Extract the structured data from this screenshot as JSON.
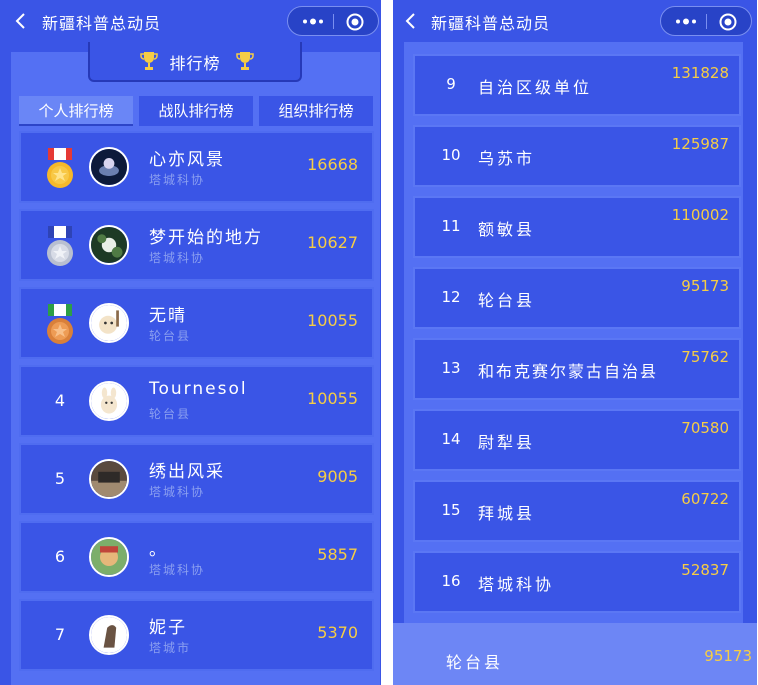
{
  "app": {
    "title": "新疆科普总动员"
  },
  "banner": {
    "label": "排行榜"
  },
  "tabs": [
    {
      "label": "个人排行榜"
    },
    {
      "label": "战队排行榜"
    },
    {
      "label": "组织排行榜"
    }
  ],
  "personal": [
    {
      "rank": "1",
      "name": "心亦风景",
      "org": "塔城科协",
      "score": "16668",
      "medal": "gold-medal-icon"
    },
    {
      "rank": "2",
      "name": "梦开始的地方",
      "org": "塔城科协",
      "score": "10627",
      "medal": "silver-medal-icon"
    },
    {
      "rank": "3",
      "name": "无晴",
      "org": "轮台县",
      "score": "10055",
      "medal": "bronze-medal-icon"
    },
    {
      "rank": "4",
      "name": "Tournesol",
      "org": "轮台县",
      "score": "10055"
    },
    {
      "rank": "5",
      "name": "绣出风采",
      "org": "塔城科协",
      "score": "9005"
    },
    {
      "rank": "6",
      "name": "。",
      "org": "塔城科协",
      "score": "5857"
    },
    {
      "rank": "7",
      "name": "妮子",
      "org": "塔城市",
      "score": "5370"
    }
  ],
  "organizations": [
    {
      "rank": "9",
      "name": "自治区级单位",
      "score": "131828"
    },
    {
      "rank": "10",
      "name": "乌苏市",
      "score": "125987"
    },
    {
      "rank": "11",
      "name": "额敏县",
      "score": "110002"
    },
    {
      "rank": "12",
      "name": "轮台县",
      "score": "95173"
    },
    {
      "rank": "13",
      "name": "和布克赛尔蒙古自治县",
      "score": "75762"
    },
    {
      "rank": "14",
      "name": "尉犁县",
      "score": "70580"
    },
    {
      "rank": "15",
      "name": "拜城县",
      "score": "60722"
    },
    {
      "rank": "16",
      "name": "塔城科协",
      "score": "52837"
    }
  ],
  "my_org": {
    "name": "轮台县",
    "score": "95173"
  },
  "colors": {
    "background": "#3a55e6",
    "board": "#5470f3",
    "score": "#f6cd45",
    "footer": "#6d86f5"
  }
}
